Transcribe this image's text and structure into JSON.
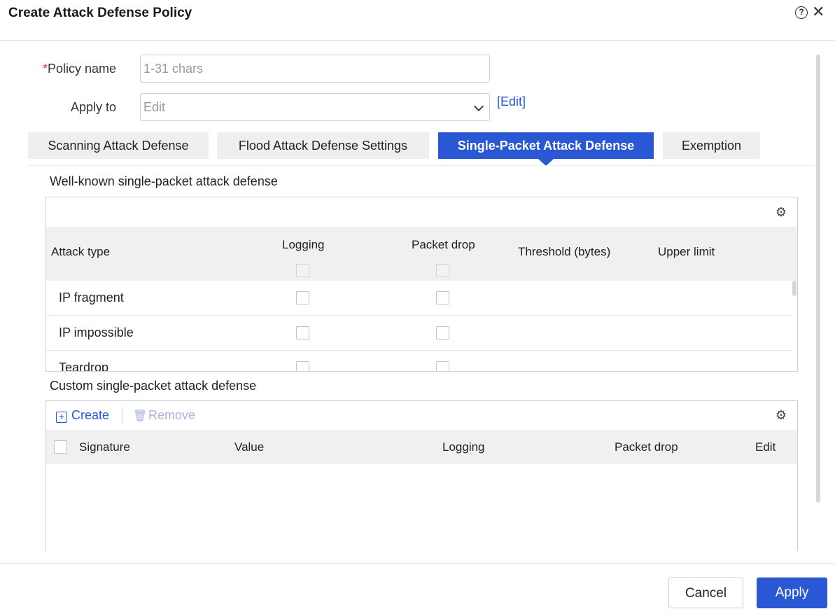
{
  "dialog": {
    "title": "Create Attack Defense Policy",
    "help_icon": "question-circle-icon",
    "close_icon": "close-icon"
  },
  "form": {
    "policy_name": {
      "required_mark": "*",
      "label": "Policy name",
      "placeholder": "1-31 chars",
      "value": ""
    },
    "apply_to": {
      "label": "Apply to",
      "placeholder": "Edit",
      "edit_link": "[Edit]"
    }
  },
  "tabs": [
    {
      "label": "Scanning Attack Defense",
      "active": false
    },
    {
      "label": "Flood Attack Defense Settings",
      "active": false
    },
    {
      "label": "Single-Packet Attack Defense",
      "active": true
    },
    {
      "label": "Exemption",
      "active": false
    }
  ],
  "well_known": {
    "title": "Well-known single-packet attack defense",
    "columns": {
      "attack_type": "Attack type",
      "logging": "Logging",
      "packet_drop": "Packet drop",
      "threshold": "Threshold (bytes)",
      "upper_limit": "Upper limit"
    },
    "rows": [
      {
        "attack_type": "IP fragment",
        "logging": false,
        "packet_drop": false
      },
      {
        "attack_type": "IP impossible",
        "logging": false,
        "packet_drop": false
      },
      {
        "attack_type": "Teardrop",
        "logging": false,
        "packet_drop": false
      }
    ]
  },
  "custom": {
    "title": "Custom single-packet attack defense",
    "toolbar": {
      "create": "Create",
      "remove": "Remove"
    },
    "columns": {
      "signature": "Signature",
      "value": "Value",
      "logging": "Logging",
      "packet_drop": "Packet drop",
      "edit": "Edit"
    }
  },
  "footer": {
    "cancel": "Cancel",
    "apply": "Apply"
  },
  "colors": {
    "primary": "#2a58d4",
    "required": "#d9302a"
  }
}
